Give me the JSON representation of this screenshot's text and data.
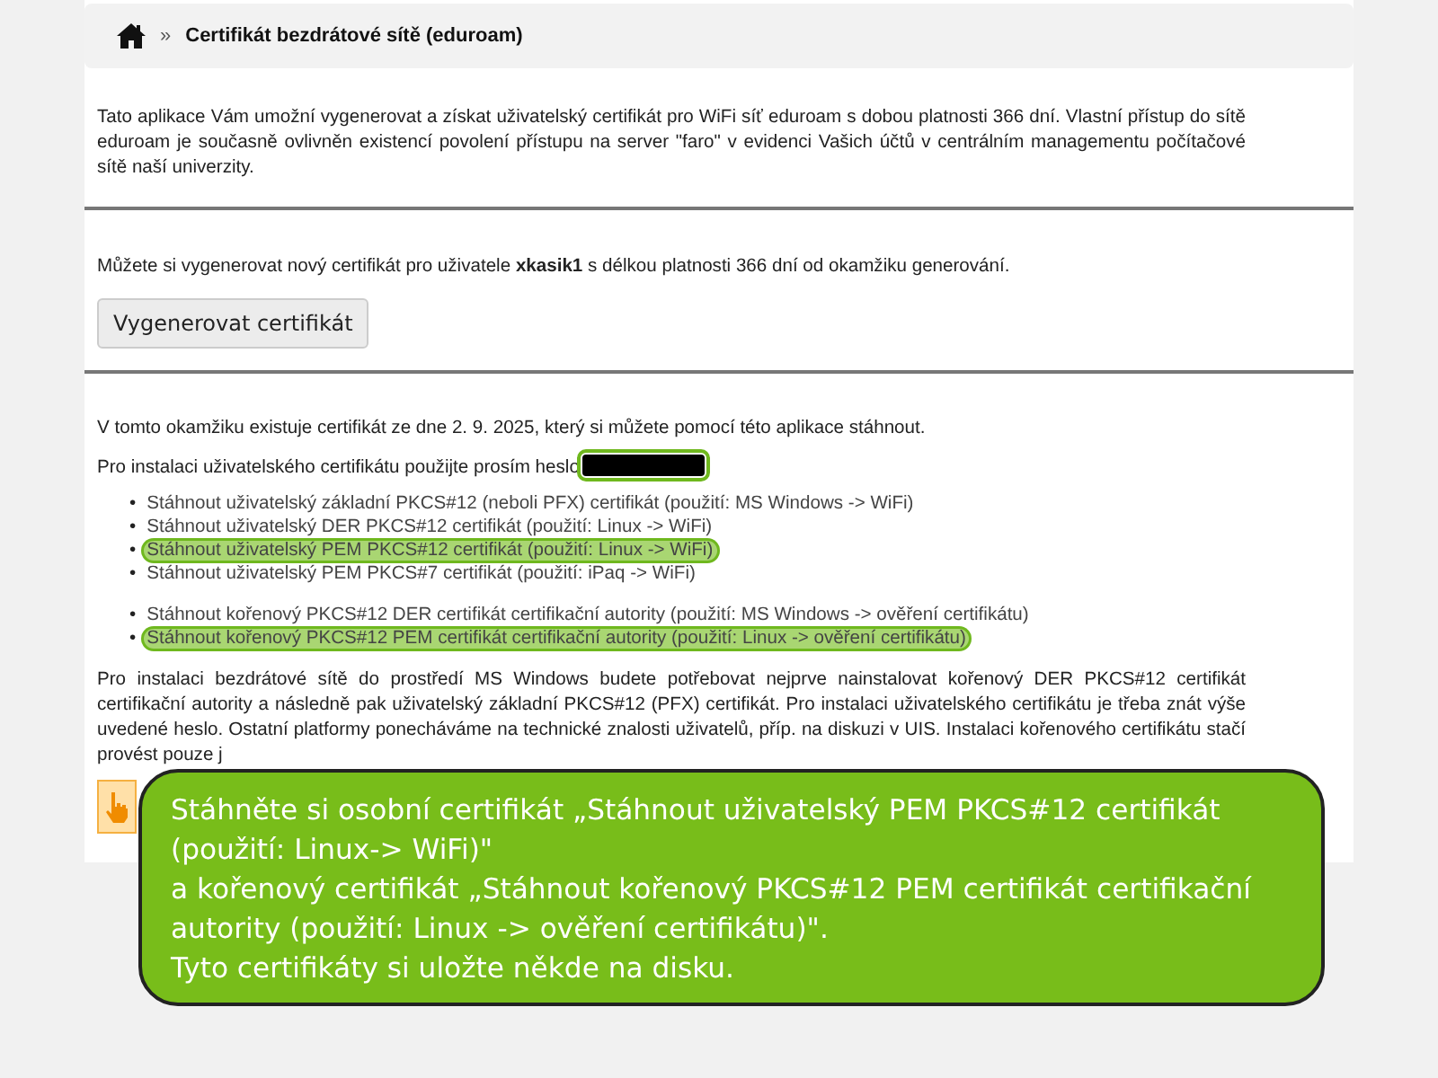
{
  "breadcrumb": {
    "separator": "»",
    "title": "Certifikát bezdrátové sítě (eduroam)"
  },
  "intro": "Tato aplikace Vám umožní vygenerovat a získat uživatelský certifikát pro WiFi síť eduroam s dobou platnosti 366 dní. Vlastní přístup do sítě eduroam je současně ovlivněn existencí povolení přístupu na server \"faro\" v evidenci Vašich účtů v centrálním managementu počítačové sítě naší univerzity.",
  "generate": {
    "text": "Můžete si vygenerovat nový certifikát pro uživatele **xkasik1** s délkou platnosti 366 dní od okamžiku generování.",
    "button": "Vygenerovat certifikát"
  },
  "existing": "V tomto okamžiku existuje certifikát ze dne 2. 9. 2025, který si můžete pomocí této aplikace stáhnout.",
  "password": {
    "label": "Pro instalaci uživatelského certifikátu použijte prosím heslo",
    "redacted": true,
    "highlighted": true
  },
  "bullet": "•",
  "link_groups": [
    [
      {
        "label": "Stáhnout uživatelský základní PKCS#12 (neboli PFX) certifikát (použití: MS Windows -> WiFi)",
        "highlighted": false
      },
      {
        "label": "Stáhnout uživatelský DER PKCS#12 certifikát (použití: Linux -> WiFi)",
        "highlighted": false
      },
      {
        "label": "Stáhnout uživatelský PEM PKCS#12 certifikát (použití: Linux -> WiFi)",
        "highlighted": true
      },
      {
        "label": "Stáhnout uživatelský PEM PKCS#7 certifikát (použití: iPaq -> WiFi)",
        "highlighted": false
      }
    ],
    [
      {
        "label": "Stáhnout kořenový PKCS#12 DER certifikát certifikační autority (použití: MS Windows -> ověření certifikátu)",
        "highlighted": false
      },
      {
        "label": "Stáhnout kořenový PKCS#12 PEM certifikát certifikační autority (použití: Linux -> ověření certifikátu)",
        "highlighted": true
      }
    ]
  ],
  "windows_note": "Pro instalaci bezdrátové sítě do prostředí MS Windows budete potřebovat nejprve nainstalovat kořenový DER PKCS#12 certifikát certifikační autority a následně pak uživatelský základní PKCS#12 (PFX) certifikát. Pro instalaci uživatelského certifikátu je třeba znát výše uvedené heslo. Ostatní platformy ponecháváme na technické znalosti uživatelů, příp. na diskuzi v UIS. Instalaci kořenového certifikátu stačí provést pouze j",
  "callout": [
    "Stáhněte si osobní certifikát „Stáhnout uživatelský PEM PKCS#12 certifikát (použití: Linux-> WiFi)\"",
    "a kořenový certifikát „Stáhnout kořenový PKCS#12 PEM certifikát certifikační autority (použití: Linux -> ověření certifikátu)\".",
    "Tyto certifikáty si uložte někde na disku."
  ]
}
